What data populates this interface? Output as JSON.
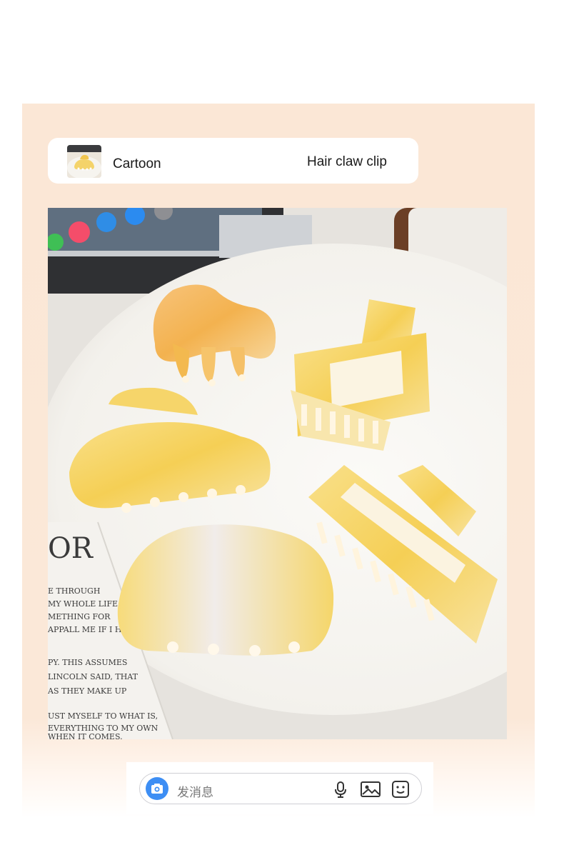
{
  "header": {
    "brand_label": "Cartoon",
    "product_label": "Hair claw clip"
  },
  "photo": {
    "book_lines": [
      "OR",
      "E THROUGH",
      "MY WHOLE LIFE",
      "METHING FOR",
      "APPALL ME IF I HAD",
      "PY. THIS ASSUMES",
      "LINCOLN SAID, THAT",
      "AS THEY MAKE UP",
      "UST MYSELF TO WHAT IS,",
      "EVERYTHING TO MY OWN",
      "WHEN IT COMES."
    ]
  },
  "message_bar": {
    "placeholder": "发消息",
    "icons": [
      "camera-icon",
      "microphone-icon",
      "image-icon",
      "emoji-icon"
    ],
    "accent_color": "#3d8ef4"
  }
}
